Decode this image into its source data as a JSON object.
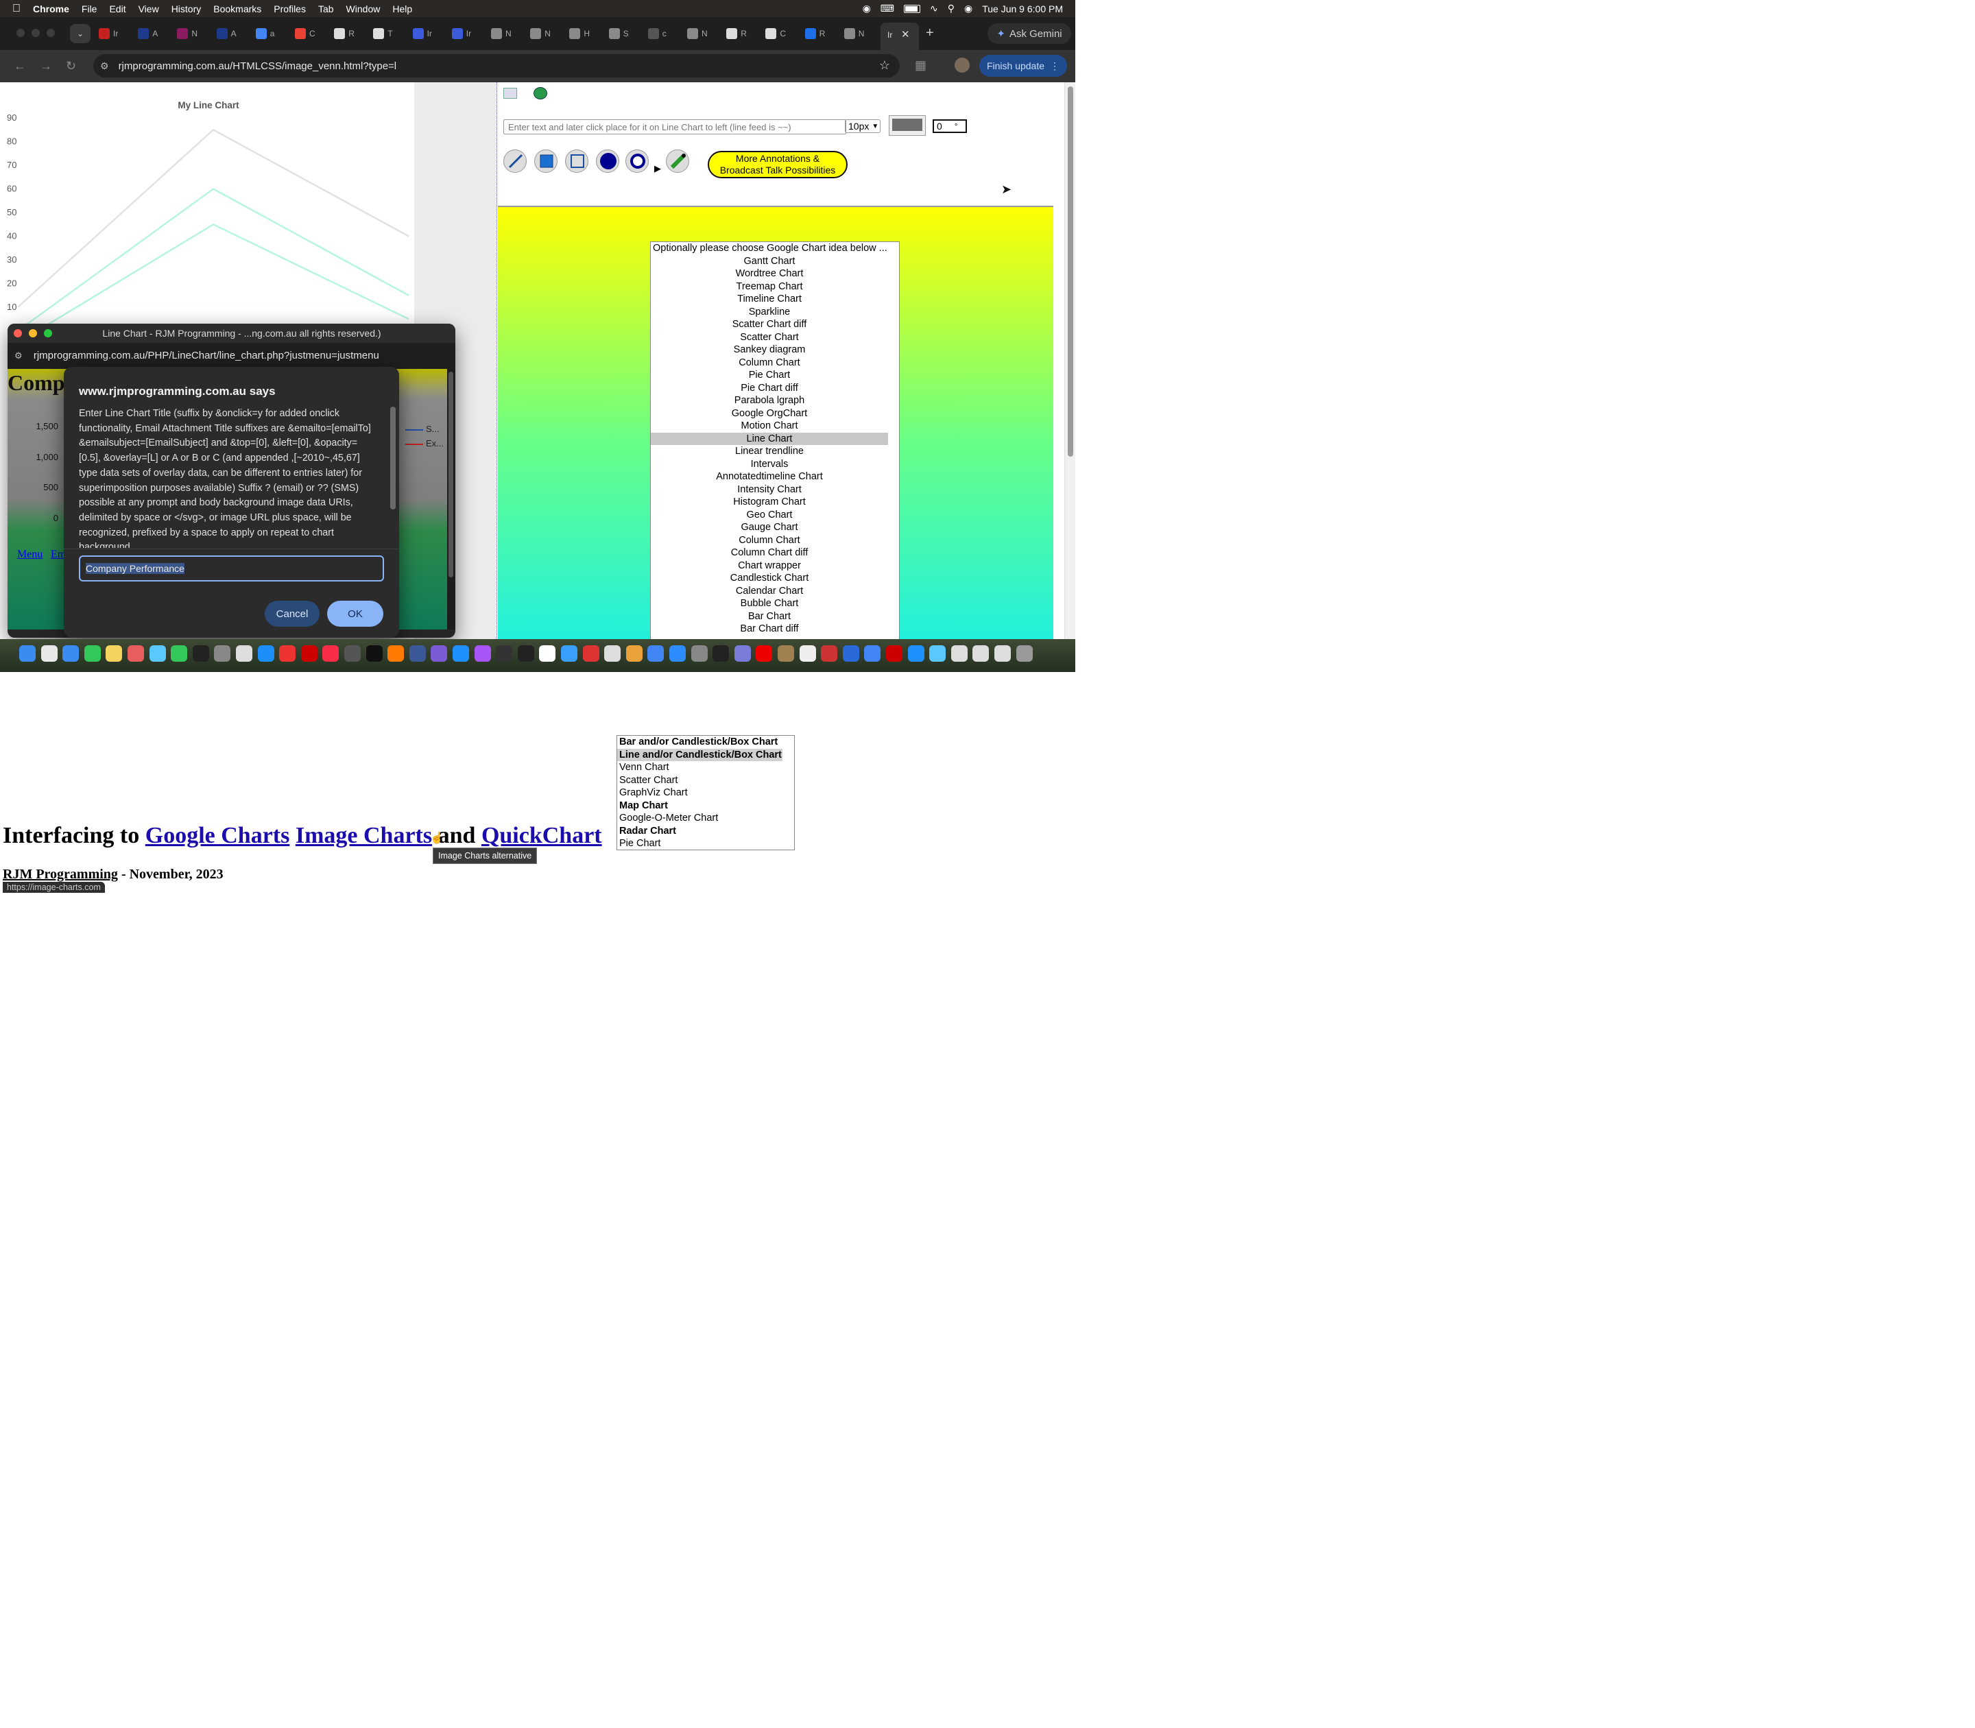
{
  "menubar": {
    "app": "Chrome",
    "items": [
      "File",
      "Edit",
      "View",
      "History",
      "Bookmarks",
      "Profiles",
      "Tab",
      "Window",
      "Help"
    ],
    "clock": "Tue Jun 9  6:00 PM"
  },
  "tabs": [
    {
      "letter": "Ir",
      "icon": "gmail-icon",
      "color": "#c5221f"
    },
    {
      "letter": "A",
      "icon": "s-app-icon",
      "color": "#1e3a8a"
    },
    {
      "letter": "N",
      "icon": "feather-icon",
      "color": "#8b1c62"
    },
    {
      "letter": "A",
      "icon": "s-app-icon",
      "color": "#1e3a8a"
    },
    {
      "letter": "a",
      "icon": "google-icon",
      "color": "#4285f4"
    },
    {
      "letter": "C",
      "icon": "chrome-icon",
      "color": "#ea4335"
    },
    {
      "letter": "R",
      "icon": "page-icon",
      "color": "#dddddd"
    },
    {
      "letter": "T",
      "icon": "page-icon",
      "color": "#dddddd"
    },
    {
      "letter": "Ir",
      "icon": "chart-icon",
      "color": "#3b5bdb"
    },
    {
      "letter": "Ir",
      "icon": "chart-icon",
      "color": "#3b5bdb"
    },
    {
      "letter": "N",
      "icon": "openai-icon",
      "color": "#8a8a8a"
    },
    {
      "letter": "N",
      "icon": "openai-icon",
      "color": "#8a8a8a"
    },
    {
      "letter": "H",
      "icon": "history-icon",
      "color": "#8a8a8a"
    },
    {
      "letter": "S",
      "icon": "gear-icon",
      "color": "#8a8a8a"
    },
    {
      "letter": "c",
      "icon": "circle-icon",
      "color": "#555555"
    },
    {
      "letter": "N",
      "icon": "openai-icon",
      "color": "#8a8a8a"
    },
    {
      "letter": "R",
      "icon": "page-icon",
      "color": "#dddddd"
    },
    {
      "letter": "C",
      "icon": "page-icon",
      "color": "#dddddd"
    },
    {
      "letter": "R",
      "icon": "opera-icon",
      "color": "#1f6feb"
    },
    {
      "letter": "N",
      "icon": "openai-icon",
      "color": "#8a8a8a"
    }
  ],
  "active_tab": {
    "letter": "Ir"
  },
  "gemini": {
    "label": "Ask Gemini"
  },
  "address": {
    "url": "rjmprogramming.com.au/HTMLCSS/image_venn.html?type=l",
    "update_label": "Finish update"
  },
  "left_chart": {
    "title": "My Line Chart"
  },
  "chart_data": {
    "type": "line",
    "title": "My Line Chart",
    "xlabel": "",
    "ylabel": "",
    "ylim": [
      0,
      90
    ],
    "y_ticks": [
      10,
      20,
      30,
      40,
      50,
      60,
      70,
      80,
      90
    ],
    "x": [
      0,
      1,
      2
    ],
    "series": [
      {
        "values": [
          10,
          85,
          40
        ],
        "color": "#e2e2e2"
      },
      {
        "values": [
          0,
          60,
          15
        ],
        "color": "#b7f5de"
      },
      {
        "values": [
          -5,
          45,
          5
        ],
        "color": "#b7f5de"
      }
    ],
    "grid": false
  },
  "annotate": {
    "text_placeholder": "Enter text and later click place for it on Line Chart to left (line feed is ~~)",
    "font_size": "10px",
    "rotation": "0",
    "degree_symbol": "°",
    "swatch_color": "#6f6f6f",
    "tools": [
      "line-tool-icon",
      "filled-rect-tool-icon",
      "rect-tool-icon",
      "filled-circle-tool-icon",
      "circle-tool-icon",
      "pencil-tool-icon"
    ],
    "more_line1": "More Annotations &",
    "more_line2": "Broadcast Talk Possibilities"
  },
  "google_chart_list": {
    "options": [
      "Optionally please choose Google Chart idea below ...",
      "Gantt Chart",
      "Wordtree Chart",
      "Treemap Chart",
      "Timeline Chart",
      "Sparkline",
      "Scatter Chart diff",
      "Scatter Chart",
      "Sankey diagram",
      "Column Chart",
      "Pie Chart",
      "Pie Chart diff",
      "Parabola lgraph",
      "Google OrgChart",
      "Motion Chart",
      "Line Chart",
      "Linear trendline",
      "Intervals",
      "Annotatedtimeline Chart",
      "Intensity Chart",
      "Histogram Chart",
      "Geo Chart",
      "Gauge Chart",
      "Column Chart",
      "Column Chart diff",
      "Chart wrapper",
      "Candlestick Chart",
      "Calendar Chart",
      "Bubble Chart",
      "Bar Chart",
      "Bar Chart diff"
    ],
    "selected": "Line Chart"
  },
  "popup": {
    "title": "Line Chart - RJM Programming - ...ng.com.au all rights reserved.)",
    "url": "rjmprogramming.com.au/PHP/LineChart/line_chart.php?justmenu=justmenu",
    "heading_fragment": "Comp",
    "y_ticks": [
      "1,500",
      "1,000",
      "500",
      "0"
    ],
    "legend": [
      "S...",
      "Ex..."
    ],
    "links": [
      "Menu",
      "Em"
    ]
  },
  "dialog": {
    "title": "www.rjmprogramming.com.au says",
    "message": "Enter Line Chart Title (suffix by &onclick=y for added onclick functionality,  Email Attachment Title suffixes are &emailto=[emailTo] &emailsubject=[EmailSubject] and &top=[0],  &left=[0], &opacity=[0.5], &overlay=[L] or A or B or C (and appended ,[~2010~,45,67] type data sets of overlay data, can be different to entries later) for superimposition purposes available)  Suffix ? (email) or ?? (SMS) possible at any prompt and  body background image data URIs, delimited by space or </svg>, or image URL plus space, will be recognized, prefixed by a space to apply on repeat to chart background",
    "input_value": "Company Performance",
    "cancel": "Cancel",
    "ok": "OK"
  },
  "lower": {
    "headline_prefix": "Interfacing to ",
    "link_google": "Google Charts",
    "link_image": "Image Charts",
    "and": " and ",
    "link_quick": "QuickChart",
    "sub_link": "RJM Programming",
    "sub_rest": " - November, 2023",
    "tooltip": "Image Charts alternative",
    "status_url": "https://image-charts.com",
    "types": [
      "Bar and/or Candlestick/Box Chart",
      "Line and/or Candlestick/Box Chart",
      "Venn Chart",
      "Scatter Chart",
      "GraphViz Chart",
      "Map Chart",
      "Google-O-Meter Chart",
      "Radar Chart",
      "Pie Chart"
    ],
    "bold_types": [
      "Bar and/or Candlestick/Box Chart",
      "Line and/or Candlestick/Box Chart",
      "Map Chart",
      "Radar Chart"
    ],
    "selected_type": "Line and/or Candlestick/Box Chart"
  }
}
